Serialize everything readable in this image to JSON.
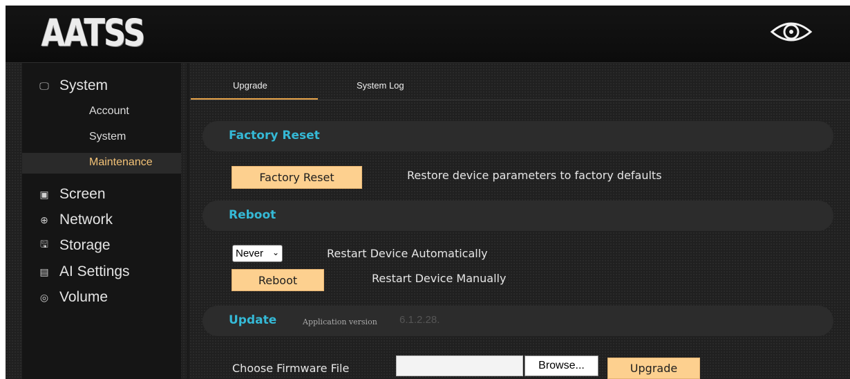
{
  "header": {
    "logo_text": "AATSS",
    "eye_icon": "eye-icon"
  },
  "sidebar": {
    "items": [
      {
        "icon": "monitor-icon",
        "glyph": "🖵",
        "label": "System"
      },
      {
        "icon": "image-icon",
        "glyph": "▣",
        "label": "Screen"
      },
      {
        "icon": "globe-icon",
        "glyph": "⊕",
        "label": "Network"
      },
      {
        "icon": "floppy-icon",
        "glyph": "🖫",
        "label": "Storage"
      },
      {
        "icon": "document-icon",
        "glyph": "▤",
        "label": "AI Settings"
      },
      {
        "icon": "volume-icon",
        "glyph": "◎",
        "label": "Volume"
      }
    ],
    "system_sub": [
      "Account",
      "System",
      "Maintenance"
    ],
    "active_sub": "Maintenance",
    "active_color": "#f3c277"
  },
  "tabs": [
    {
      "label": "Upgrade",
      "active": true
    },
    {
      "label": "System Log",
      "active": false
    }
  ],
  "factory_reset": {
    "title": "Factory Reset",
    "button_label": "Factory Reset",
    "description": "Restore device parameters to factory defaults"
  },
  "reboot": {
    "title": "Reboot",
    "auto_select_value": "Never",
    "auto_label": "Restart Device Automatically",
    "button_label": "Reboot",
    "manual_label": "Restart Device Manually"
  },
  "update": {
    "title": "Update",
    "app_version_label": "Application version",
    "app_version_value": "6.1.2.28.",
    "file_label": "Choose Firmware File",
    "file_value": "",
    "browse_label": "Browse...",
    "upgrade_label": "Upgrade"
  },
  "colors": {
    "accent_title": "#35b9d6",
    "button_bg": "#fdd08f",
    "tab_underline": "#e8a44a"
  }
}
